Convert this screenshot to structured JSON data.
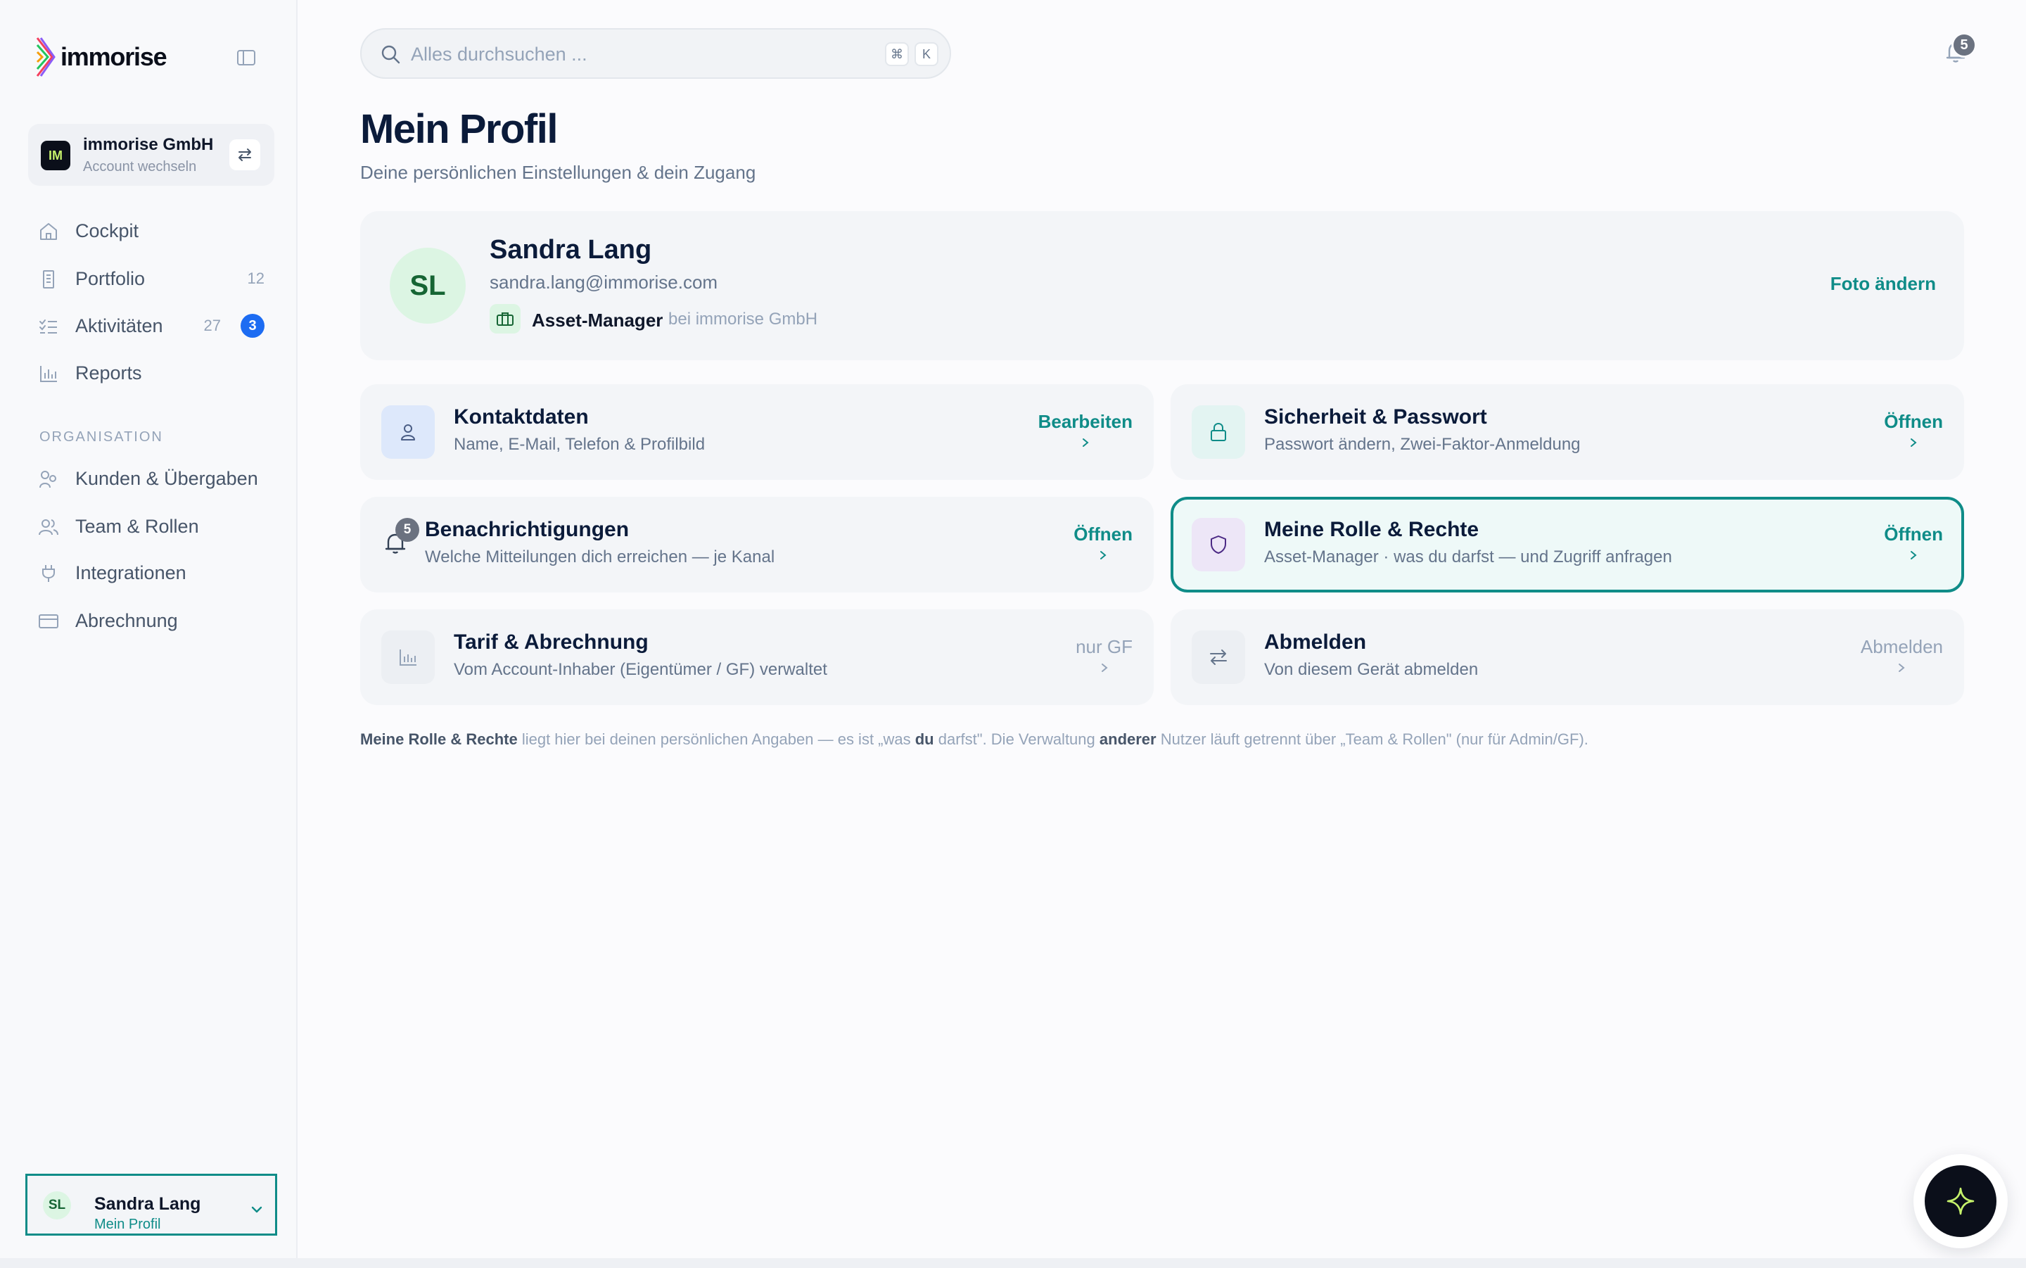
{
  "app": {
    "logo_text": "immorise"
  },
  "account": {
    "initials": "IM",
    "name": "immorise GmbH",
    "switch_label": "Account wechseln"
  },
  "nav": {
    "main": [
      {
        "label": "Cockpit",
        "icon": "home-icon"
      },
      {
        "label": "Portfolio",
        "count": "12",
        "icon": "building-icon"
      },
      {
        "label": "Aktivitäten",
        "count": "27",
        "badge": "3",
        "icon": "checklist-icon"
      },
      {
        "label": "Reports",
        "icon": "bar-chart-icon"
      }
    ],
    "section_title": "ORGANISATION",
    "org": [
      {
        "label": "Kunden & Übergaben",
        "icon": "handshake-icon"
      },
      {
        "label": "Team & Rollen",
        "icon": "users-icon"
      },
      {
        "label": "Integrationen",
        "icon": "plug-icon"
      },
      {
        "label": "Abrechnung",
        "icon": "credit-card-icon"
      }
    ]
  },
  "user": {
    "initials": "SL",
    "name": "Sandra Lang",
    "sub": "Mein Profil"
  },
  "search": {
    "placeholder": "Alles durchsuchen ...",
    "kbd1": "⌘",
    "kbd2": "K"
  },
  "notifications": {
    "count": "5"
  },
  "page": {
    "title": "Mein Profil",
    "subtitle": "Deine persönlichen Einstellungen & dein Zugang"
  },
  "profile": {
    "initials": "SL",
    "name": "Sandra Lang",
    "email": "sandra.lang@immorise.com",
    "role": "Asset-Manager",
    "org": "bei immorise GmbH",
    "photo_action": "Foto ändern"
  },
  "tiles": [
    {
      "title": "Kontaktdaten",
      "sub": "Name, E-Mail, Telefon & Profilbild",
      "action": "Bearbeiten"
    },
    {
      "title": "Sicherheit & Passwort",
      "sub": "Passwort ändern, Zwei-Faktor-Anmeldung",
      "action": "Öffnen"
    },
    {
      "title": "Benachrichtigungen",
      "sub": "Welche Mitteilungen dich erreichen — je Kanal",
      "action": "Öffnen",
      "badge": "5"
    },
    {
      "title": "Meine Rolle & Rechte",
      "sub": "Asset-Manager · was du darfst — und Zugriff anfragen",
      "action": "Öffnen"
    },
    {
      "title": "Tarif & Abrechnung",
      "sub": "Vom Account-Inhaber (Eigentümer / GF) verwaltet",
      "action": "nur GF"
    },
    {
      "title": "Abmelden",
      "sub": "Von diesem Gerät abmelden",
      "action": "Abmelden"
    }
  ],
  "footnote": {
    "b1": "Meine Rolle & Rechte",
    "t1": " liegt hier bei deinen persönlichen Angaben — es ist „was ",
    "b2": "du",
    "t2": " darfst\". Die Verwaltung ",
    "b3": "anderer",
    "t3": " Nutzer läuft getrennt über „Team & Rollen\" (nur für Admin/GF)."
  },
  "colors": {
    "accent": "#0f8c88",
    "brand_dark": "#0b0f1a",
    "badge_blue": "#1d6cf2",
    "lime": "#c6f26b"
  }
}
